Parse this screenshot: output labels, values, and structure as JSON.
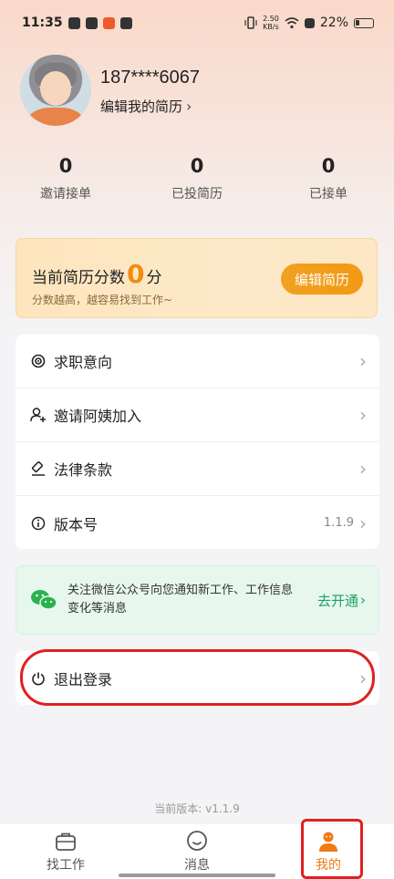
{
  "status_bar": {
    "time": "11:35",
    "net_speed": "2.50\nKB/s",
    "battery": "22%"
  },
  "profile": {
    "phone": "187****6067",
    "edit_link": "编辑我的简历",
    "chevron": "›"
  },
  "stats": [
    {
      "value": "0",
      "label": "邀请接单"
    },
    {
      "value": "0",
      "label": "已投简历"
    },
    {
      "value": "0",
      "label": "已接单"
    }
  ],
  "score_card": {
    "title_prefix": "当前简历分数",
    "score": "0",
    "title_suffix": "分",
    "hint": "分数越高，越容易找到工作~",
    "button": "编辑简历"
  },
  "menu": [
    {
      "label": "求职意向",
      "icon": "target-icon",
      "value": ""
    },
    {
      "label": "邀请阿姨加入",
      "icon": "add-user-icon",
      "value": ""
    },
    {
      "label": "法律条款",
      "icon": "gavel-icon",
      "value": ""
    },
    {
      "label": "版本号",
      "icon": "info-icon",
      "value": "1.1.9"
    }
  ],
  "wechat": {
    "text": "关注微信公众号向您通知新工作、工作信息变化等消息",
    "action": "去开通",
    "icon": "wechat-icon"
  },
  "logout": {
    "label": "退出登录",
    "icon": "power-icon"
  },
  "footer": {
    "version": "当前版本: v1.1.9"
  },
  "bottom_nav": [
    {
      "label": "找工作",
      "icon": "briefcase-icon",
      "active": false
    },
    {
      "label": "消息",
      "icon": "smile-chat-icon",
      "active": false
    },
    {
      "label": "我的",
      "icon": "person-icon",
      "active": true
    }
  ],
  "colors": {
    "accent": "#f08c12",
    "wechat_green": "#1aa260",
    "highlight_red": "#e02020"
  }
}
